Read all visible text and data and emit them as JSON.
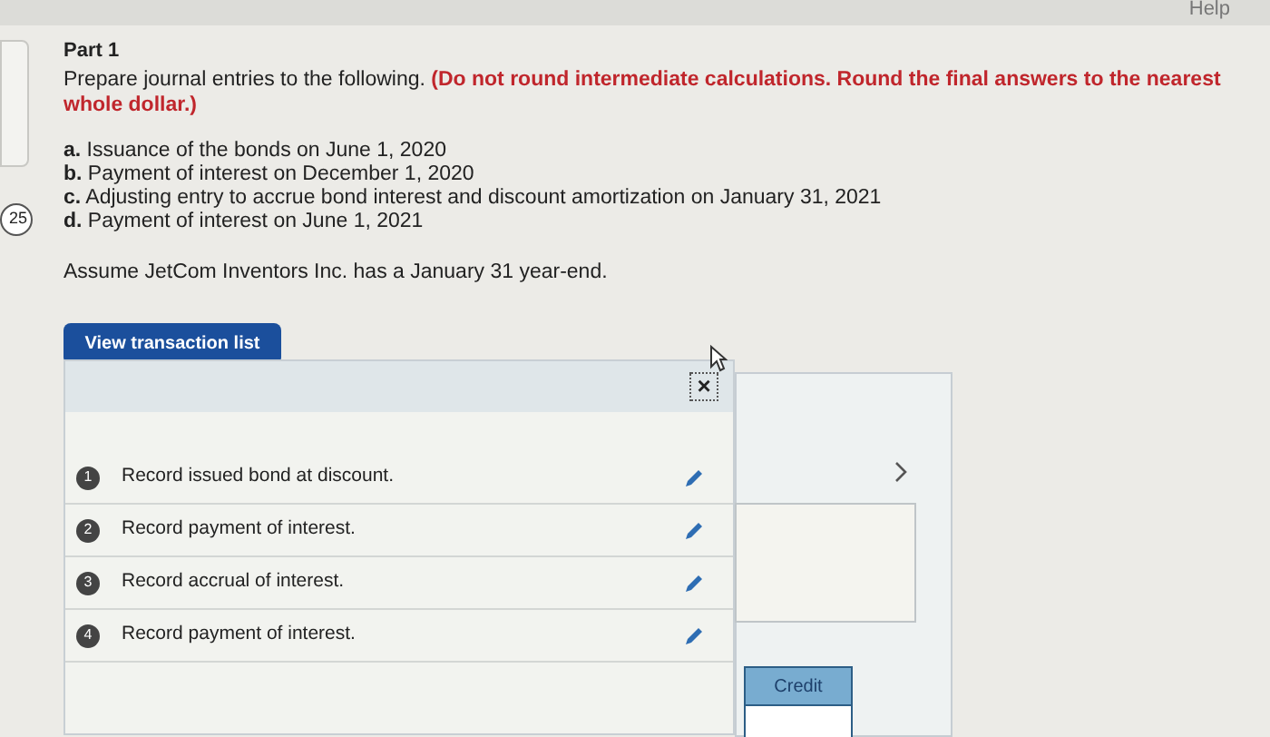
{
  "top_bar": {
    "help": "Help"
  },
  "side_badge": "25",
  "part": "Part 1",
  "instruction": "Prepare journal entries to the following. **(Do not round intermediate calculations. Round the final answers to the nearest whole dollar.)**",
  "items": [
    "**a.** Issuance of the bonds on June 1, 2020",
    "**b.** Payment of interest on December 1, 2020",
    "**c.** Adjusting entry to accrue bond interest and discount amortization on January 31, 2021",
    "**d.** Payment of interest on June 1, 2021"
  ],
  "assumption": "Assume JetCom Inventors Inc. has a January 31 year-end.",
  "view_button": "View transaction list",
  "transaction_panel": {
    "close": "×",
    "transactions": [
      {
        "number": "1",
        "label": "Record issued bond at discount."
      },
      {
        "number": "2",
        "label": "Record payment of interest."
      },
      {
        "number": "3",
        "label": "Record accrual of interest."
      },
      {
        "number": "4",
        "label": "Record payment of interest."
      }
    ]
  },
  "journal": {
    "credit_header": "Credit"
  }
}
